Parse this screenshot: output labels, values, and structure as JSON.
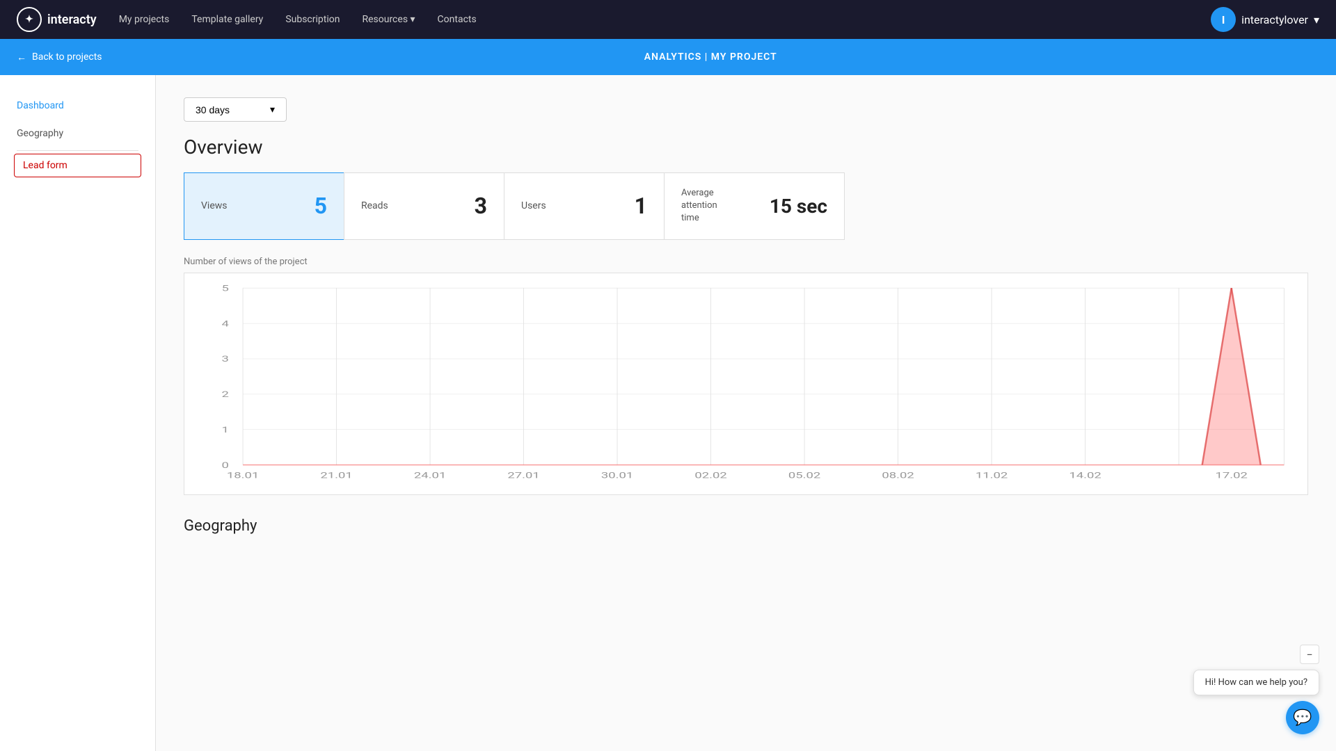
{
  "nav": {
    "brand": "interacty",
    "user_initial": "I",
    "username": "interactylover",
    "links": [
      {
        "label": "My projects",
        "has_arrow": false
      },
      {
        "label": "Template gallery",
        "has_arrow": false
      },
      {
        "label": "Subscription",
        "has_arrow": false
      },
      {
        "label": "Resources",
        "has_arrow": true
      },
      {
        "label": "Contacts",
        "has_arrow": false
      }
    ]
  },
  "subheader": {
    "back_label": "Back to projects",
    "title_analytics": "ANALYTICS",
    "title_separator": " | ",
    "title_project": "MY PROJECT"
  },
  "sidebar": {
    "items": [
      {
        "label": "Dashboard",
        "state": "active"
      },
      {
        "label": "Geography",
        "state": "normal"
      },
      {
        "label": "Lead form",
        "state": "boxed"
      }
    ]
  },
  "main": {
    "dropdown_label": "30 days",
    "overview_title": "Overview",
    "stats": [
      {
        "label": "Views",
        "value": "5",
        "active": true
      },
      {
        "label": "Reads",
        "value": "3",
        "active": false
      },
      {
        "label": "Users",
        "value": "1",
        "active": false
      },
      {
        "label_line1": "Average",
        "label_line2": "attention",
        "label_line3": "time",
        "value": "15 sec",
        "active": false
      }
    ],
    "chart_label": "Number of views of the project",
    "chart": {
      "y_labels": [
        "0",
        "1",
        "2",
        "3",
        "4",
        "5"
      ],
      "x_labels": [
        "18.01",
        "21.01",
        "24.01",
        "27.01",
        "30.01",
        "02.02",
        "05.02",
        "08.02",
        "11.02",
        "14.02",
        "17.02"
      ]
    }
  },
  "geography_title": "Geography",
  "chat": {
    "tooltip": "Hi! How can we help you?",
    "collapse_icon": "−"
  },
  "colors": {
    "brand_blue": "#2196F3",
    "nav_bg": "#1a1a2e",
    "active_card_bg": "#e3f2fd",
    "chart_bar_fill": "rgba(255, 100, 100, 0.35)",
    "chart_bar_stroke": "rgba(220, 60, 60, 0.7)"
  }
}
